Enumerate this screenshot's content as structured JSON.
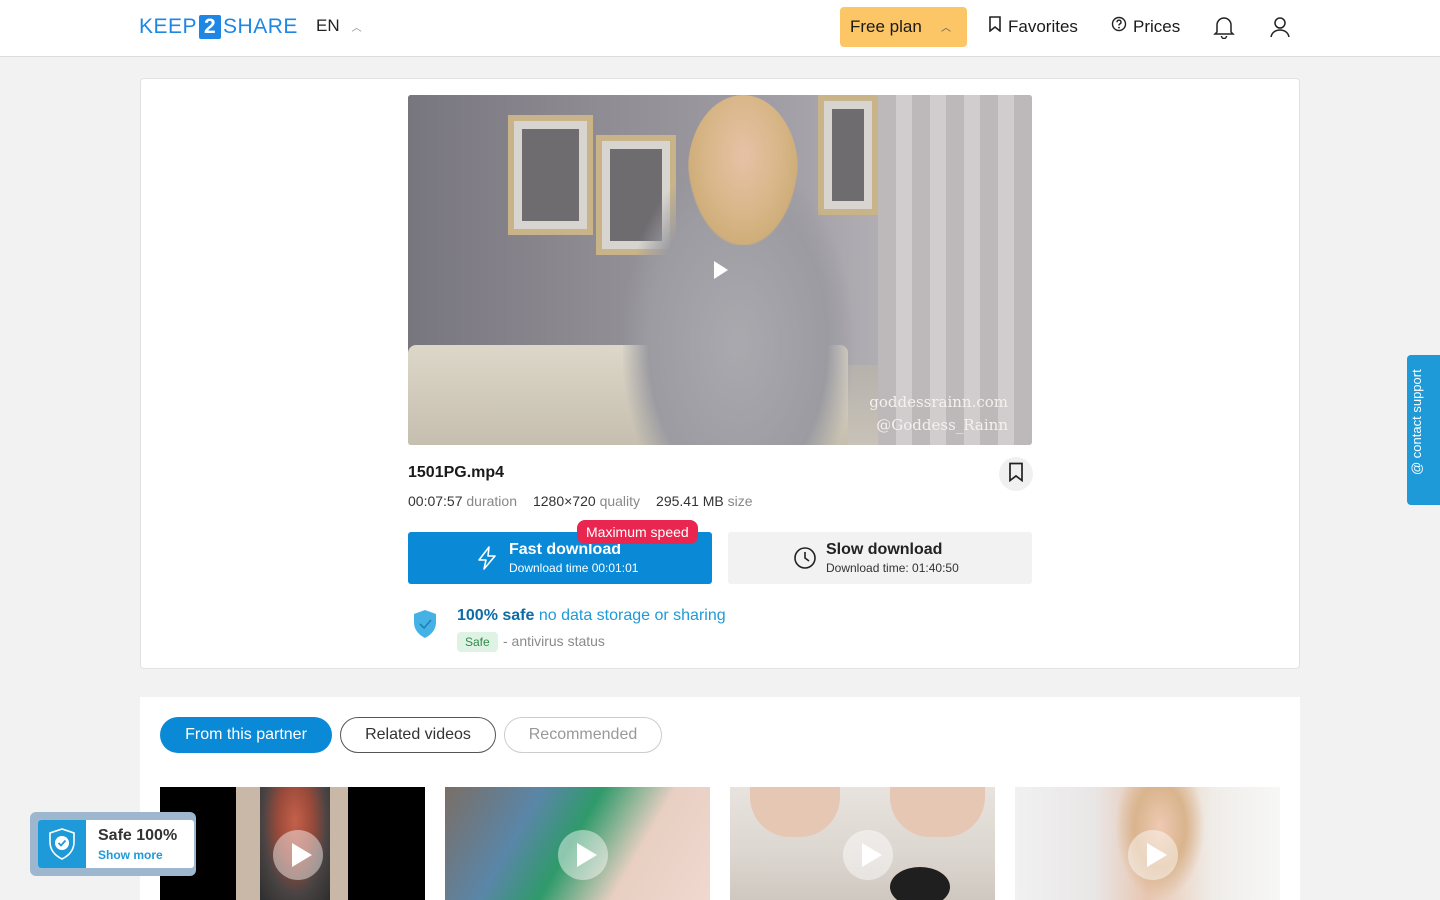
{
  "header": {
    "logo_left": "KEEP",
    "logo_mid": "2",
    "logo_right": "SHARE",
    "language": "EN",
    "plan_label": "Free plan",
    "favorites_label": "Favorites",
    "prices_label": "Prices"
  },
  "file": {
    "name": "1501PG.mp4",
    "duration_value": "00:07:57",
    "duration_unit": "duration",
    "quality_value": "1280×720",
    "quality_unit": "quality",
    "size_value": "295.41 MB",
    "size_unit": "size",
    "watermark_line1": "goddessrainn.com",
    "watermark_line2": "@Goddess_Rainn"
  },
  "download": {
    "fast_title": "Fast download",
    "fast_sub": "Download time 00:01:01",
    "fast_badge": "Maximum speed",
    "slow_title": "Slow download",
    "slow_sub": "Download time: 01:40:50"
  },
  "safety": {
    "bold": "100% safe",
    "rest": " no data storage or sharing",
    "badge": "Safe",
    "status": "- antivirus status"
  },
  "tabs": [
    {
      "label": "From this partner",
      "state": "active"
    },
    {
      "label": "Related videos",
      "state": "default"
    },
    {
      "label": "Recommended",
      "state": "disabled"
    }
  ],
  "support_label": "@ contact support",
  "safe_widget": {
    "title": "Safe 100%",
    "link": "Show more"
  },
  "colors": {
    "accent": "#0a8ad6",
    "plan": "#fcc566",
    "badge_red": "#e8264f",
    "safe_green_bg": "#dff3e4"
  }
}
